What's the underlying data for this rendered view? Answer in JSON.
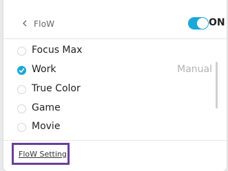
{
  "header": {
    "back_icon": "chevron-left-icon",
    "title": "FloW",
    "toggle_state": "ON",
    "toggle_color": "#1aa8d8"
  },
  "modes": [
    {
      "label": "Focus Max",
      "checked": false,
      "tag": ""
    },
    {
      "label": "Work",
      "checked": true,
      "tag": "Manual"
    },
    {
      "label": "True Color",
      "checked": false,
      "tag": ""
    },
    {
      "label": "Game",
      "checked": false,
      "tag": ""
    },
    {
      "label": "Movie",
      "checked": false,
      "tag": ""
    }
  ],
  "footer": {
    "setting_label": "FloW Setting",
    "highlight_color": "#6a3d9a"
  }
}
